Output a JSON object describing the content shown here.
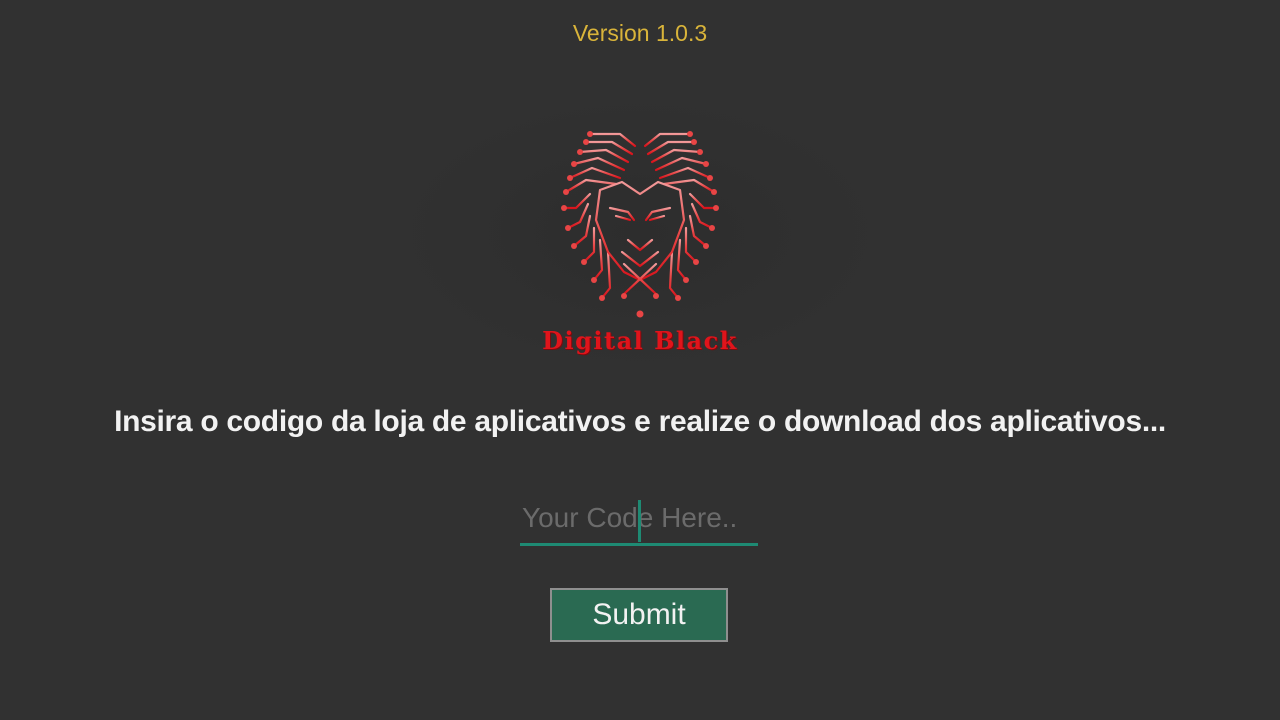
{
  "header": {
    "version": "Version 1.0.3"
  },
  "logo": {
    "icon": "lion-circuit-icon",
    "brand_name": "Digital Black"
  },
  "main": {
    "message": "Insira o codigo da loja de aplicativos e realize o download dos aplicativos...",
    "code_input": {
      "value": "",
      "placeholder": "Your Code Here.."
    },
    "submit_label": "Submit"
  },
  "colors": {
    "background": "#313131",
    "version_text": "#d9b43a",
    "brand_red": "#e0141b",
    "accent_teal": "#1e8a73",
    "button_green": "#2a6a52"
  }
}
